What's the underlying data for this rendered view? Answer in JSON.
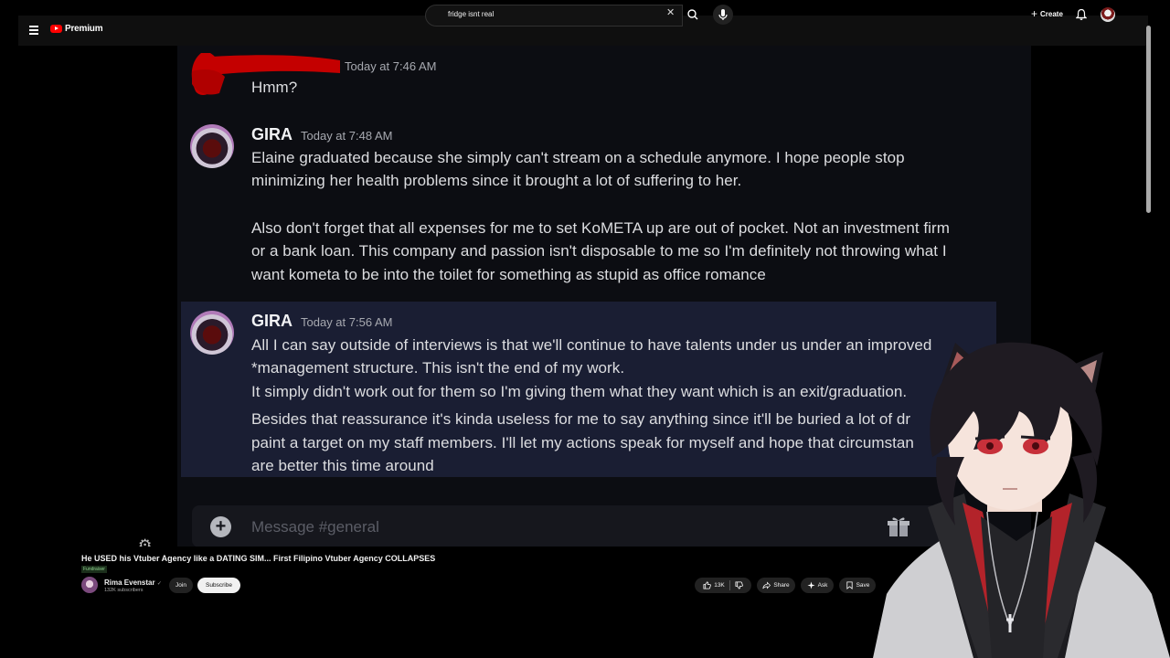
{
  "header": {
    "logo_text": "Premium",
    "search_value": "fridge isnt real",
    "create_label": "Create"
  },
  "chat": {
    "first": {
      "timestamp": "Today at 7:46 AM",
      "text": "Hmm?"
    },
    "messages": [
      {
        "author": "GIRA",
        "timestamp": "Today at 7:48 AM",
        "lines": [
          "Elaine graduated because she simply can't stream on a schedule anymore. I hope people stop",
          "minimizing her health problems since it brought a lot of suffering to her.",
          "Also don't forget that all expenses for me to set KoMETA up are out of pocket. Not an investment firm",
          "or a bank loan. This company and passion isn't disposable to me so I'm definitely not throwing what I",
          "want kometa to be into the toilet for something as stupid as office romance"
        ]
      },
      {
        "author": "GIRA",
        "timestamp": "Today at 7:56 AM",
        "lines": [
          "All I can say outside of interviews is that we'll continue to have talents under us under an improved",
          "*management structure. This isn't the end of my work.",
          "It simply didn't work out for them so I'm giving them what they want which is an exit/graduation.",
          "Besides that reassurance it's kinda useless for me to say anything since it'll be buried a lot of dr",
          "paint a target on my staff members. I'll let my actions speak for myself and hope that circumstan",
          "are better this time around"
        ]
      }
    ],
    "input_placeholder": "Message #general"
  },
  "video": {
    "title": "He USED his Vtuber Agency like a DATING SIM... First Filipino Vtuber Agency COLLAPSES",
    "badge": "Fundraiser",
    "channel": "Rima Evenstar",
    "verified_glyph": "✓",
    "subscribers": "132K subscribers",
    "join_label": "Join",
    "subscribe_label": "Subscribe",
    "likes": "13K",
    "share_label": "Share",
    "ask_label": "Ask",
    "save_label": "Save"
  },
  "colors": {
    "youtube_red": "#ff0000",
    "chat_bg": "#0c0d12",
    "highlight_bg": "#1a1e33",
    "redaction": "#c40000"
  }
}
